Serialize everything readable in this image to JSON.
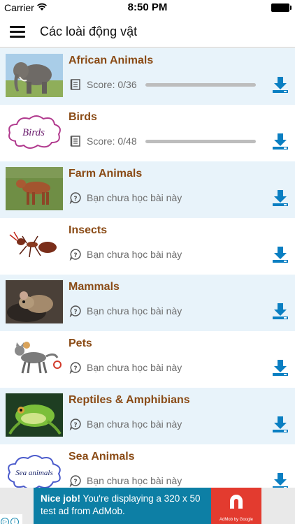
{
  "status_bar": {
    "carrier": "Carrier",
    "time": "8:50 PM"
  },
  "header": {
    "title": "Các loài động vật"
  },
  "lessons": [
    {
      "title": "African Animals",
      "subtitle": "Score: 0/36",
      "has_progress": true,
      "progress": 0,
      "thumb": "elephant"
    },
    {
      "title": "Birds",
      "subtitle": "Score: 0/48",
      "has_progress": true,
      "progress": 0,
      "thumb": "birds-cloud"
    },
    {
      "title": "Farm Animals",
      "subtitle": "Bạn chưa học bài này",
      "has_progress": false,
      "thumb": "calf"
    },
    {
      "title": "Insects",
      "subtitle": "Bạn chưa học bài này",
      "has_progress": false,
      "thumb": "ant"
    },
    {
      "title": "Mammals",
      "subtitle": "Bạn chưa học bài này",
      "has_progress": false,
      "thumb": "mouse"
    },
    {
      "title": "Pets",
      "subtitle": "Bạn chưa học bài này",
      "has_progress": false,
      "thumb": "cat"
    },
    {
      "title": "Reptiles & Amphibians",
      "subtitle": "Bạn chưa học bài này",
      "has_progress": false,
      "thumb": "frog"
    },
    {
      "title": "Sea Animals",
      "subtitle": "Bạn chưa học bài này",
      "has_progress": false,
      "thumb": "sea-cloud"
    }
  ],
  "thumb_labels": {
    "birds": "Birds",
    "sea": "Sea animals"
  },
  "ad": {
    "headline": "Nice job!",
    "body_line1": " You're displaying a 320 x 50",
    "body_line2": "test ad from AdMob.",
    "logo_text": "AdMob by Google"
  },
  "colors": {
    "title": "#8a4b16",
    "row_alt": "#e8f3fa",
    "download": "#0a7fc2",
    "ad_bg": "#0d7fa5",
    "ad_logo": "#e33b2f"
  }
}
